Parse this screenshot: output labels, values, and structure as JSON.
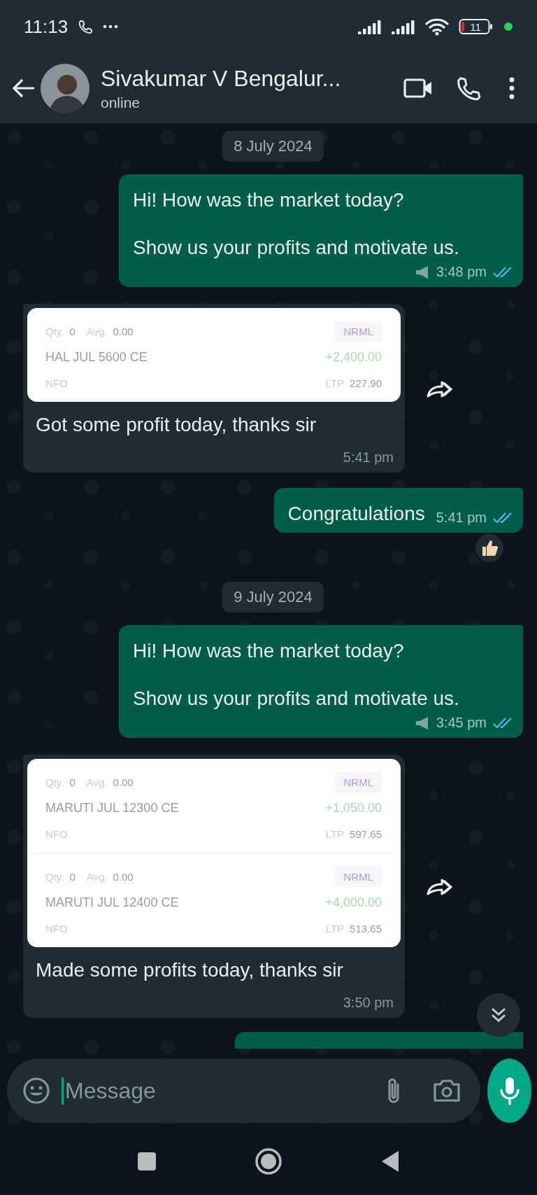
{
  "status_bar": {
    "time": "11:13",
    "battery": "11"
  },
  "header": {
    "name": "Sivakumar V Bengalur...",
    "status": "online"
  },
  "messages": [
    {
      "kind": "date",
      "text": "8 July 2024"
    },
    {
      "kind": "outgoing",
      "paragraphs": [
        "Hi! How was the market today?",
        "Show us your profits and motivate us."
      ],
      "time": "3:48 pm",
      "read": true,
      "broadcast": true
    },
    {
      "kind": "incoming",
      "positions": [
        {
          "qty_label": "Qty.",
          "qty": "0",
          "avg_label": "Avg.",
          "avg": "0.00",
          "product": "NRML",
          "symbol": "HAL JUL 5600 CE",
          "pnl": "+2,400.00",
          "exchange": "NFO",
          "ltp_label": "LTP",
          "ltp": "227.90"
        }
      ],
      "text": "Got some profit today, thanks sir",
      "time": "5:41 pm",
      "forward": true
    },
    {
      "kind": "outgoing",
      "paragraphs": [
        "Congratulations"
      ],
      "time": "5:41 pm",
      "read": true,
      "broadcast": false,
      "reacted": true
    },
    {
      "kind": "date",
      "text": "9 July 2024"
    },
    {
      "kind": "outgoing",
      "paragraphs": [
        "Hi! How was the market today?",
        "Show us your profits and motivate us."
      ],
      "time": "3:45 pm",
      "read": true,
      "broadcast": true
    },
    {
      "kind": "incoming",
      "positions": [
        {
          "qty_label": "Qty.",
          "qty": "0",
          "avg_label": "Avg.",
          "avg": "0.00",
          "product": "NRML",
          "symbol": "MARUTI JUL 12300 CE",
          "pnl": "+1,050.00",
          "exchange": "NFO",
          "ltp_label": "LTP",
          "ltp": "597.65"
        },
        {
          "qty_label": "Qty.",
          "qty": "0",
          "avg_label": "Avg.",
          "avg": "0.00",
          "product": "NRML",
          "symbol": "MARUTI JUL 12400 CE",
          "pnl": "+4,000.00",
          "exchange": "NFO",
          "ltp_label": "LTP",
          "ltp": "513.65"
        }
      ],
      "text": "Made some profits today, thanks sir",
      "time": "3:50 pm",
      "forward": true
    },
    {
      "kind": "outgoing_cut"
    }
  ],
  "composer": {
    "placeholder": "Message"
  }
}
